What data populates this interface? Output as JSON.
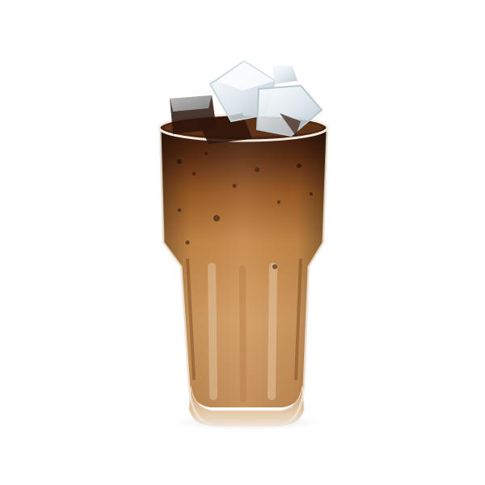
{
  "image": {
    "subject": "iced-coffee-glass",
    "background_color": "#ffffff",
    "colors": {
      "espresso_top": "#3a1d0f",
      "coffee_mid": "#b87a3c",
      "milk_bottom": "#d7a46c",
      "foam_rim": "#6b3a1c",
      "glass_edge": "#f2ede6",
      "ice": "#e9f0f4"
    }
  }
}
